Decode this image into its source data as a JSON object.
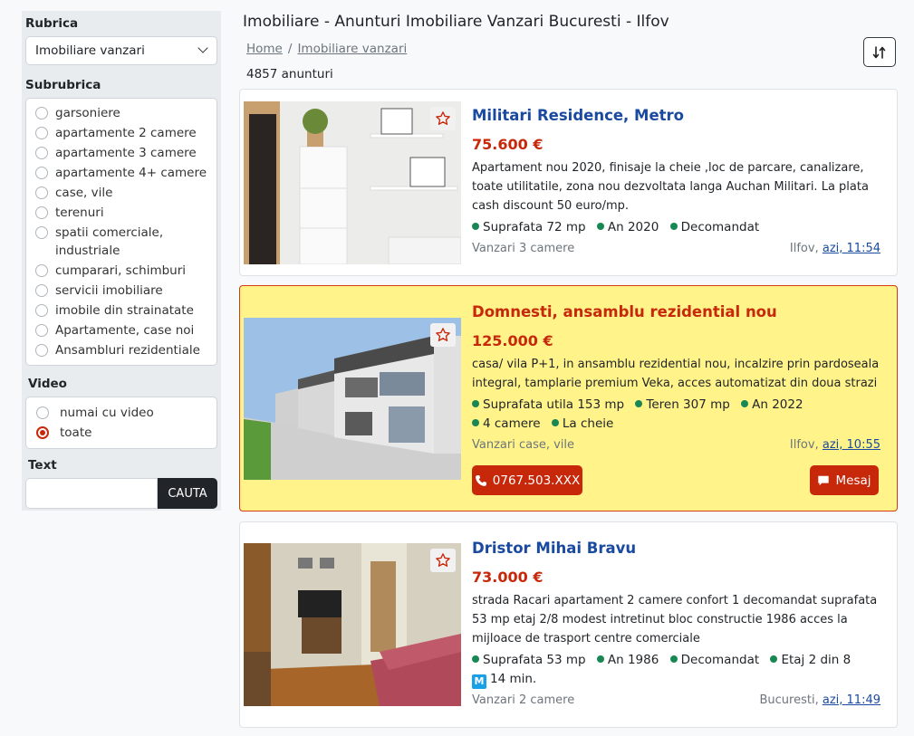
{
  "sidebar": {
    "rubrica_label": "Rubrica",
    "rubrica_value": "Imobiliare vanzari",
    "subrubrica_label": "Subrubrica",
    "subrubrici": [
      "garsoniere",
      "apartamente 2 camere",
      "apartamente 3 camere",
      "apartamente 4+ camere",
      "case, vile",
      "terenuri",
      "spatii comerciale, industriale",
      "cumparari, schimburi",
      "servicii imobiliare",
      "imobile din strainatate",
      "Apartamente, case noi",
      "Ansambluri rezidentiale"
    ],
    "video_label": "Video",
    "video_options": [
      "numai cu video",
      "toate"
    ],
    "video_selected": "toate",
    "text_label": "Text",
    "search_button": "CAUTA"
  },
  "header": {
    "title": "Imobiliare - Anunturi Imobiliare Vanzari Bucuresti - Ilfov",
    "breadcrumb": [
      "Home",
      "Imobiliare vanzari"
    ],
    "count": "4857 anunturi"
  },
  "listings": [
    {
      "title": "Militari Residence, Metro",
      "price": "75.600 €",
      "description": "Apartament nou 2020, finisaje la cheie ,loc de parcare, canalizare, toate utilitatile, zona nou dezvoltata langa Auchan Militari. La plata cash discount 50 euro/mp.",
      "features": [
        "Suprafata 72 mp",
        "An 2020",
        "Decomandat"
      ],
      "category": "Vanzari 3 camere",
      "location": "Ilfov,",
      "time": "azi, 11:54"
    },
    {
      "title": "Domnesti, ansamblu rezidential nou",
      "price": "125.000 €",
      "description": "casa/ vila P+1, in ansamblu rezidential nou, incalzire prin pardoseala integral, tamplarie premium Veka, acces automatizat din doua strazi",
      "features": [
        "Suprafata utila 153 mp",
        "Teren 307 mp",
        "An 2022",
        "4 camere",
        "La cheie"
      ],
      "category": "Vanzari case, vile",
      "location": "Ilfov,",
      "time": "azi, 10:55",
      "phone": "0767.503.XXX",
      "message": "Mesaj"
    },
    {
      "title": "Dristor Mihai Bravu",
      "price": "73.000 €",
      "description": "strada Racari apartament 2 camere confort 1 decomandat suprafata 53 mp etaj 2/8 modest intretinut bloc constructie 1986 acces la mijloace de trasport centre comerciale",
      "features": [
        "Suprafata 53 mp",
        "An 1986",
        "Decomandat",
        "Etaj 2 din 8"
      ],
      "metro_badge": "M",
      "metro_time": "14 min.",
      "category": "Vanzari 2 camere",
      "location": "Bucuresti,",
      "time": "azi, 11:49"
    }
  ],
  "colors": {
    "accent": "#c8280a",
    "link": "#1a4aa0",
    "premium_bg": "#fff38a",
    "feature_dot": "#198754"
  }
}
